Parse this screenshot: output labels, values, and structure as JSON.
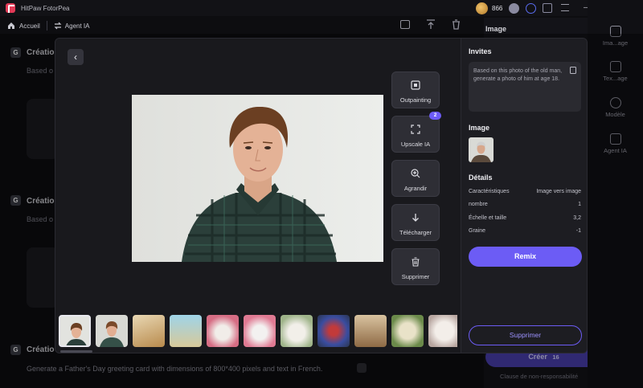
{
  "app": {
    "title": "HitPaw FotorPea",
    "credits": "866",
    "window_controls": [
      "—",
      "□",
      "✕"
    ]
  },
  "toolbar": {
    "home_label": "Accueil",
    "agent_label": "Agent IA"
  },
  "background_list": {
    "items": [
      {
        "title": "Créatio",
        "subtitle": "Based o"
      },
      {
        "title": "Créatio",
        "subtitle": "Based o"
      },
      {
        "title": "Créatio",
        "subtitle": "Generate a Father's Day greeting card with dimensions of 800*400 pixels and text in French."
      }
    ]
  },
  "background_panel": {
    "header": "Image",
    "create_label": "Créer",
    "create_cost": "16",
    "disclaimer": "Clause de non-responsabilité"
  },
  "right_strip": {
    "items": [
      {
        "label": "Ima...age",
        "icon": "image-icon"
      },
      {
        "label": "Tex...age",
        "icon": "text-image-icon"
      },
      {
        "label": "Modèle",
        "icon": "model-icon"
      },
      {
        "label": "Agent IA",
        "icon": "agent-icon"
      }
    ]
  },
  "modal": {
    "actions": [
      {
        "label": "Outpainting",
        "icon": "outpainting-icon"
      },
      {
        "label": "Upscale IA",
        "icon": "upscale-icon",
        "badge": "2"
      },
      {
        "label": "Agrandir",
        "icon": "zoom-in-icon"
      },
      {
        "label": "Télécharger",
        "icon": "download-icon"
      },
      {
        "label": "Supprimer",
        "icon": "trash-icon"
      }
    ],
    "panel": {
      "prompts_title": "Invites",
      "prompt_text": "Based on this photo of the old man, generate a photo of him at age 18.",
      "image_title": "Image",
      "details_title": "Détails",
      "details": [
        {
          "label": "Caractéristiques",
          "value": "Image vers image"
        },
        {
          "label": "nombre",
          "value": "1"
        },
        {
          "label": "Échelle et taille",
          "value": "3,2"
        },
        {
          "label": "Graine",
          "value": "-1"
        }
      ],
      "remix_label": "Remix",
      "delete_label": "Supprimer"
    }
  }
}
